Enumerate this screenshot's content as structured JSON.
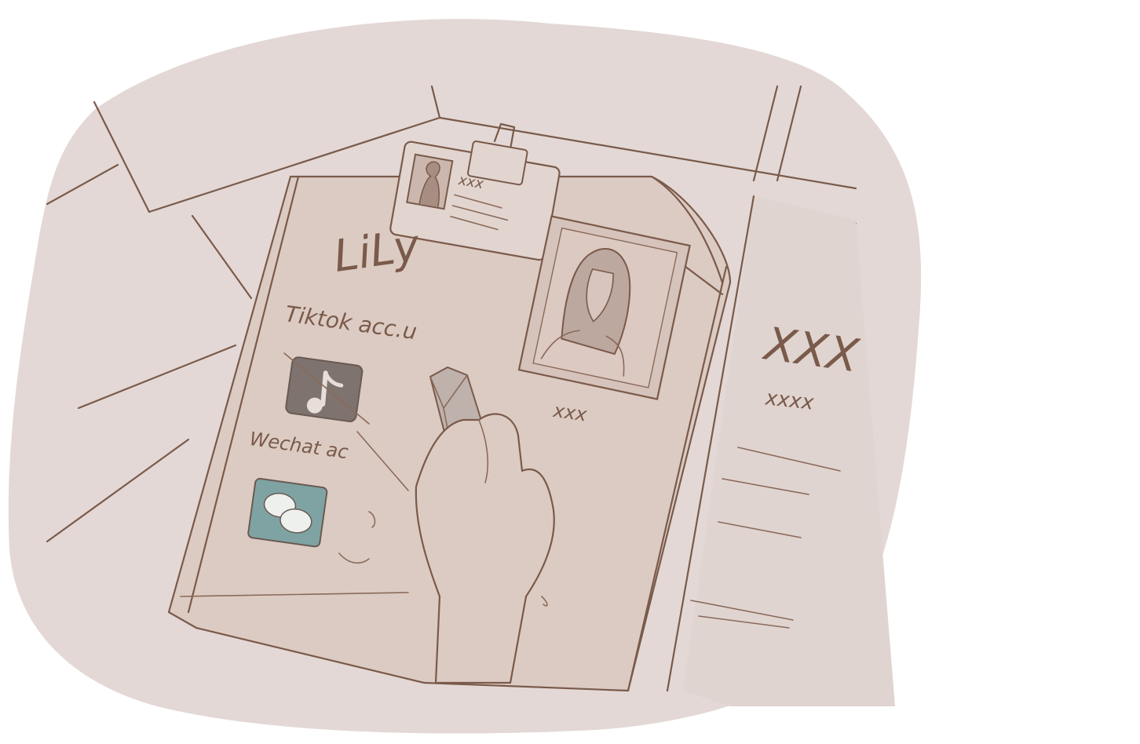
{
  "poster": {
    "name_label": "LiLy",
    "tiktok_label": "Tiktok acc.u",
    "wechat_label": "Wechat ac",
    "id_badge_text": "xxx",
    "photo_caption": "xxx"
  },
  "side_panel": {
    "heading": "XXX",
    "subheading": "xxxx"
  },
  "colors": {
    "background_wash": "#e3d8d5",
    "poster_fill": "#dccbc3",
    "line_ink": "#7a5a4a",
    "tiktok_icon_fill": "#7e736e",
    "wechat_icon_fill": "#7fa3a3"
  },
  "icons": [
    "tiktok-icon",
    "wechat-icon",
    "binder-clip-icon",
    "id-badge-icon",
    "portrait-photo",
    "eraser-icon"
  ]
}
